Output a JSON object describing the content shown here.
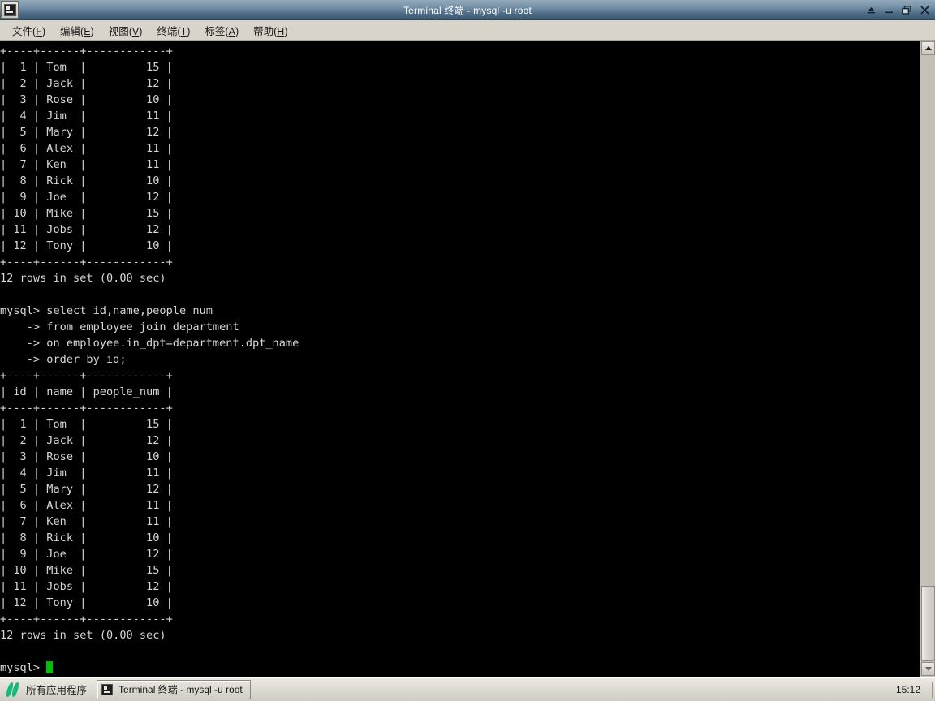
{
  "window": {
    "title": "Terminal 终端 - mysql -u root",
    "icon": "terminal-icon",
    "controls": {
      "shade_label": "▲",
      "minimize_label": "_",
      "maximize_label": "❐",
      "close_label": "✕"
    }
  },
  "menubar": {
    "items": [
      {
        "label": "文件",
        "mnemonic": "F"
      },
      {
        "label": "编辑",
        "mnemonic": "E"
      },
      {
        "label": "视图",
        "mnemonic": "V"
      },
      {
        "label": "终端",
        "mnemonic": "T"
      },
      {
        "label": "标签",
        "mnemonic": "A"
      },
      {
        "label": "帮助",
        "mnemonic": "H"
      }
    ]
  },
  "terminal": {
    "prompt": "mysql>",
    "cursor_color": "#00c000",
    "foreground": "#d6d6d6",
    "background": "#000000",
    "content": "+----+------+------------+\n|  1 | Tom  |         15 |\n|  2 | Jack |         12 |\n|  3 | Rose |         10 |\n|  4 | Jim  |         11 |\n|  5 | Mary |         12 |\n|  6 | Alex |         11 |\n|  7 | Ken  |         11 |\n|  8 | Rick |         10 |\n|  9 | Joe  |         12 |\n| 10 | Mike |         15 |\n| 11 | Jobs |         12 |\n| 12 | Tony |         10 |\n+----+------+------------+\n12 rows in set (0.00 sec)\n\nmysql> select id,name,people_num\n    -> from employee join department\n    -> on employee.in_dpt=department.dpt_name\n    -> order by id;\n+----+------+------------+\n| id | name | people_num |\n+----+------+------------+\n|  1 | Tom  |         15 |\n|  2 | Jack |         12 |\n|  3 | Rose |         10 |\n|  4 | Jim  |         11 |\n|  5 | Mary |         12 |\n|  6 | Alex |         11 |\n|  7 | Ken  |         11 |\n|  8 | Rick |         10 |\n|  9 | Joe  |         12 |\n| 10 | Mike |         15 |\n| 11 | Jobs |         12 |\n| 12 | Tony |         10 |\n+----+------+------------+\n12 rows in set (0.00 sec)\n\n",
    "query": {
      "command_line": "mysql> select id,name,people_num",
      "continuation_1": "    -> from employee join department",
      "continuation_2": "    -> on employee.in_dpt=department.dpt_name",
      "continuation_3": "    -> order by id;",
      "result_status": "12 rows in set (0.00 sec)"
    },
    "result_table": {
      "separator": "+----+------+------------+",
      "headers": [
        "id",
        "name",
        "people_num"
      ],
      "rows": [
        [
          "1",
          "Tom",
          "15"
        ],
        [
          "2",
          "Jack",
          "12"
        ],
        [
          "3",
          "Rose",
          "10"
        ],
        [
          "4",
          "Jim",
          "11"
        ],
        [
          "5",
          "Mary",
          "12"
        ],
        [
          "6",
          "Alex",
          "11"
        ],
        [
          "7",
          "Ken",
          "11"
        ],
        [
          "8",
          "Rick",
          "10"
        ],
        [
          "9",
          "Joe",
          "12"
        ],
        [
          "10",
          "Mike",
          "15"
        ],
        [
          "11",
          "Jobs",
          "12"
        ],
        [
          "12",
          "Tony",
          "10"
        ]
      ],
      "row_count_text": "12 rows in set (0.00 sec)"
    }
  },
  "scrollbar": {
    "up_arrow": "▲",
    "down_arrow": "▼"
  },
  "taskbar": {
    "launcher_label": "所有应用程序",
    "launcher_icon": "leaf-logo-icon",
    "task_label": "Terminal 终端 - mysql -u root",
    "task_icon": "terminal-icon",
    "clock": "15:12"
  }
}
